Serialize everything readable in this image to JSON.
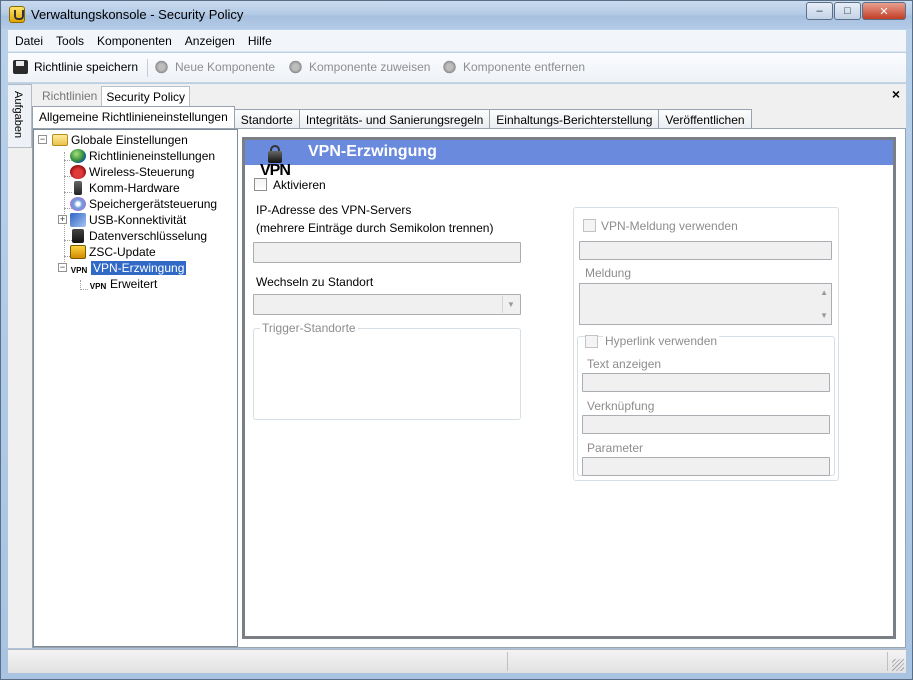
{
  "window": {
    "title": "Verwaltungskonsole - Security Policy",
    "btn_min": "–",
    "btn_max": "□",
    "btn_close": "✕"
  },
  "menu": [
    "Datei",
    "Tools",
    "Komponenten",
    "Anzeigen",
    "Hilfe"
  ],
  "toolbar": {
    "save": "Richtlinie speichern",
    "new_component": "Neue Komponente",
    "assign_component": "Komponente zuweisen",
    "remove_component": "Komponente entfernen"
  },
  "side_tab": "Aufgaben",
  "breadcrumbs": [
    "Richtlinien",
    "Security Policy"
  ],
  "pane_close": "×",
  "tabs": [
    "Allgemeine Richtlinieneinstellungen",
    "Standorte",
    "Integritäts- und Sanierungsregeln",
    "Einhaltungs-Berichterstellung",
    "Veröffentlichen"
  ],
  "tree": {
    "root": "Globale Einstellungen",
    "items": [
      "Richtlinieneinstellungen",
      "Wireless-Steuerung",
      "Komm-Hardware",
      "Speichergerätsteuerung",
      "USB-Konnektivität",
      "Datenverschlüsselung",
      "ZSC-Update",
      "VPN-Erzwingung"
    ],
    "child": "Erweitert",
    "expand_minus": "−",
    "expand_plus": "+",
    "vpn_tag": "VPN"
  },
  "detail": {
    "title": "VPN-Erzwingung",
    "logo_text": "VPN",
    "activate_label": "Aktivieren",
    "ip_label": "IP-Adresse des VPN-Servers",
    "ip_hint": "(mehrere Einträge durch Semikolon trennen)",
    "ip_value": "",
    "switch_label": "Wechseln zu Standort",
    "switch_value": "",
    "trigger_legend": "Trigger-Standorte",
    "vpn_message_label": "VPN-Meldung verwenden",
    "message_label": "Meldung",
    "hyperlink_label": "Hyperlink verwenden",
    "display_text_label": "Text anzeigen",
    "link_label": "Verknüpfung",
    "parameter_label": "Parameter",
    "combo_arrow": "▼",
    "scroll_up": "▲",
    "scroll_down": "▼"
  }
}
